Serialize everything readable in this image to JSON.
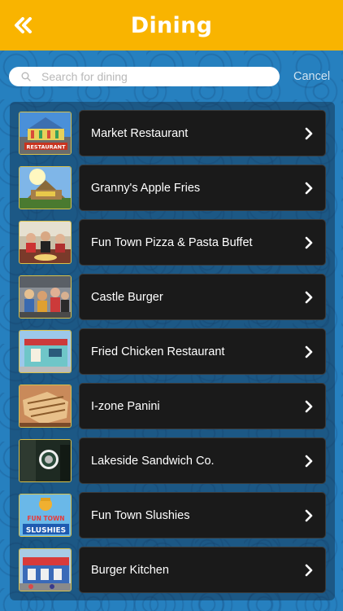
{
  "header": {
    "title": "Dining",
    "back_icon": "double-chevron-left-icon",
    "background_color": "#f9b400"
  },
  "search": {
    "placeholder": "Search for dining",
    "value": "",
    "cancel_label": "Cancel"
  },
  "list": {
    "items": [
      {
        "label": "Market Restaurant",
        "thumb": "market-restaurant-thumb",
        "thumb_text": "RESTAURANT"
      },
      {
        "label": "Granny's Apple Fries",
        "thumb": "grannys-apple-fries-thumb"
      },
      {
        "label": "Fun Town Pizza & Pasta Buffet",
        "thumb": "pizza-buffet-thumb"
      },
      {
        "label": "Castle Burger",
        "thumb": "castle-burger-thumb"
      },
      {
        "label": "Fried Chicken Restaurant",
        "thumb": "fried-chicken-thumb"
      },
      {
        "label": "I-zone Panini",
        "thumb": "panini-thumb"
      },
      {
        "label": "Lakeside Sandwich Co.",
        "thumb": "lakeside-sandwich-thumb"
      },
      {
        "label": "Fun Town Slushies",
        "thumb": "slushies-thumb",
        "thumb_text_1": "FUN TOWN",
        "thumb_text_2": "SLUSHIES"
      },
      {
        "label": "Burger Kitchen",
        "thumb": "burger-kitchen-thumb"
      }
    ]
  },
  "colors": {
    "accent": "#f9b400",
    "background": "#2680bf",
    "card": "#1a1a1a",
    "thumb_border": "#d8c04a"
  }
}
